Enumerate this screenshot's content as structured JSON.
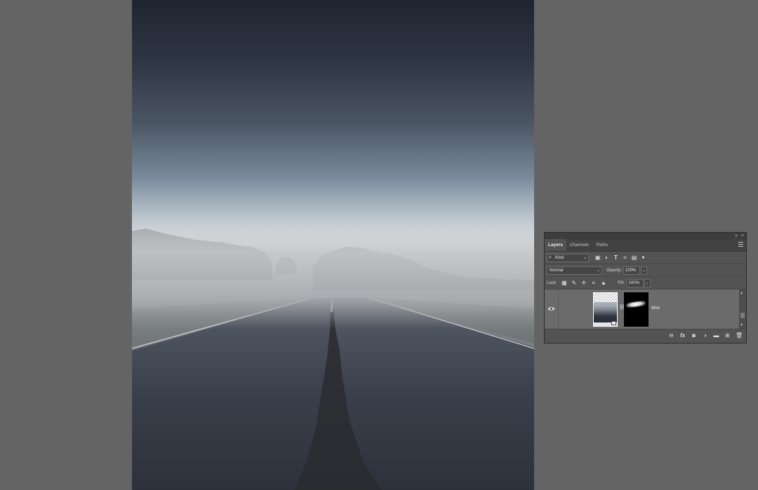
{
  "layers_panel": {
    "tabs": [
      {
        "label": "Layers",
        "active": true
      },
      {
        "label": "Channels",
        "active": false
      },
      {
        "label": "Paths",
        "active": false
      }
    ],
    "filter": {
      "kind_label": "Kind"
    },
    "blend_mode": "Normal",
    "opacity_label": "Opacity:",
    "opacity_value": "100%",
    "lock_label": "Lock:",
    "fill_label": "Fill:",
    "fill_value": "100%",
    "layers": [
      {
        "name": "Mist",
        "visible": true,
        "has_mask": true
      }
    ],
    "titlebar": {
      "collapse": "«",
      "close": "×"
    }
  },
  "colors": {
    "workspace_bg": "#646464",
    "panel_bg": "#535353",
    "selected_layer_bg": "#6b6b6b"
  },
  "icons": {
    "filter": [
      "image-filter-icon",
      "adjustment-filter-icon",
      "type-filter-icon",
      "shape-filter-icon",
      "smart-object-filter-icon",
      "toggle-filter-icon"
    ],
    "lock": [
      "lock-transparent-icon",
      "lock-image-icon",
      "lock-position-icon",
      "lock-artboard-icon",
      "lock-all-icon"
    ],
    "bottom": [
      "link-layers-icon",
      "fx-icon",
      "add-mask-icon",
      "adjustment-layer-icon",
      "new-group-icon",
      "new-layer-icon",
      "delete-layer-icon"
    ]
  }
}
